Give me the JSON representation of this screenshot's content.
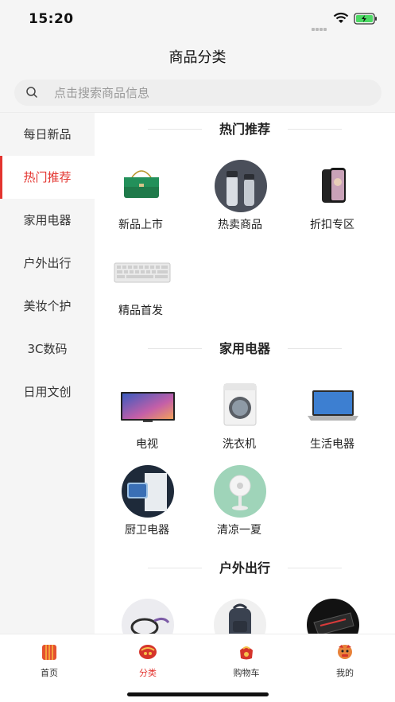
{
  "status": {
    "time": "15:20"
  },
  "nav": {
    "title": "商品分类"
  },
  "search": {
    "placeholder": "点击搜索商品信息"
  },
  "sidebar": {
    "items": [
      {
        "label": "每日新品",
        "active": false
      },
      {
        "label": "热门推荐",
        "active": true
      },
      {
        "label": "家用电器",
        "active": false
      },
      {
        "label": "户外出行",
        "active": false
      },
      {
        "label": "美妆个护",
        "active": false
      },
      {
        "label": "3C数码",
        "active": false
      },
      {
        "label": "日用文创",
        "active": false
      }
    ]
  },
  "sections": [
    {
      "title": "热门推荐",
      "items": [
        {
          "label": "新品上市",
          "icon": "green-handbag-image"
        },
        {
          "label": "热卖商品",
          "icon": "thermos-bottles-image"
        },
        {
          "label": "折扣专区",
          "icon": "smartphone-image"
        },
        {
          "label": "精品首发",
          "icon": "keyboard-image"
        }
      ]
    },
    {
      "title": "家用电器",
      "items": [
        {
          "label": "电视",
          "icon": "tv-image"
        },
        {
          "label": "洗衣机",
          "icon": "washing-machine-image"
        },
        {
          "label": "生活电器",
          "icon": "laptop-image"
        },
        {
          "label": "厨卫电器",
          "icon": "bathroom-appliance-image"
        },
        {
          "label": "清凉一夏",
          "icon": "fan-image"
        }
      ]
    },
    {
      "title": "户外出行",
      "items": [
        {
          "label": "",
          "icon": "bike-accessory-image"
        },
        {
          "label": "",
          "icon": "backpack-image"
        },
        {
          "label": "",
          "icon": "bike-bag-image"
        }
      ]
    }
  ],
  "tabbar": {
    "items": [
      {
        "label": "首页",
        "icon": "home-icon",
        "active": false
      },
      {
        "label": "分类",
        "icon": "category-icon",
        "active": true
      },
      {
        "label": "购物车",
        "icon": "cart-icon",
        "active": false
      },
      {
        "label": "我的",
        "icon": "profile-icon",
        "active": false
      }
    ]
  },
  "colors": {
    "accent": "#e3342f",
    "background": "#f5f5f5",
    "text": "#222222"
  }
}
